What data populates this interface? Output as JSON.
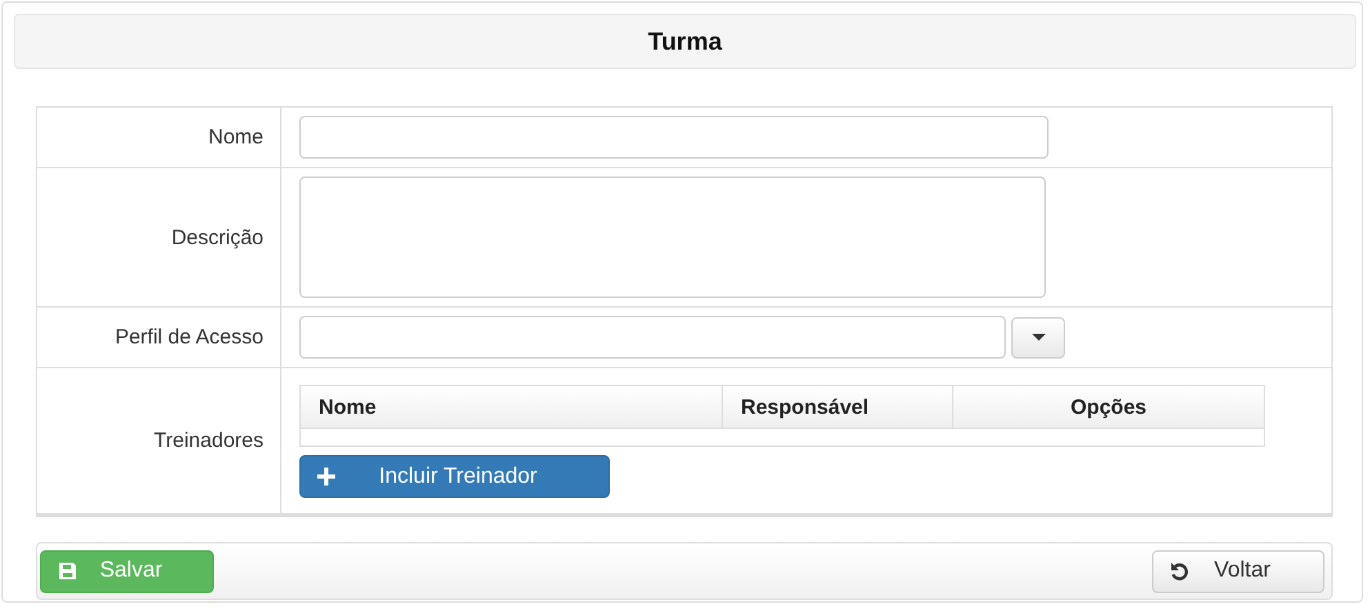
{
  "title": "Turma",
  "fields": [
    {
      "kind": "text",
      "label": "Nome"
    },
    {
      "kind": "textarea",
      "label": "Descrição"
    },
    {
      "kind": "select",
      "label": "Perfil de Acesso"
    },
    {
      "kind": "table",
      "label": "Treinadores",
      "columns": [
        "Nome",
        "Responsável",
        "Opções"
      ],
      "add_button": "Incluir Treinador"
    }
  ],
  "buttons": [
    {
      "kind": "save",
      "label": "Salvar"
    },
    {
      "kind": "back",
      "label": "Voltar"
    }
  ]
}
